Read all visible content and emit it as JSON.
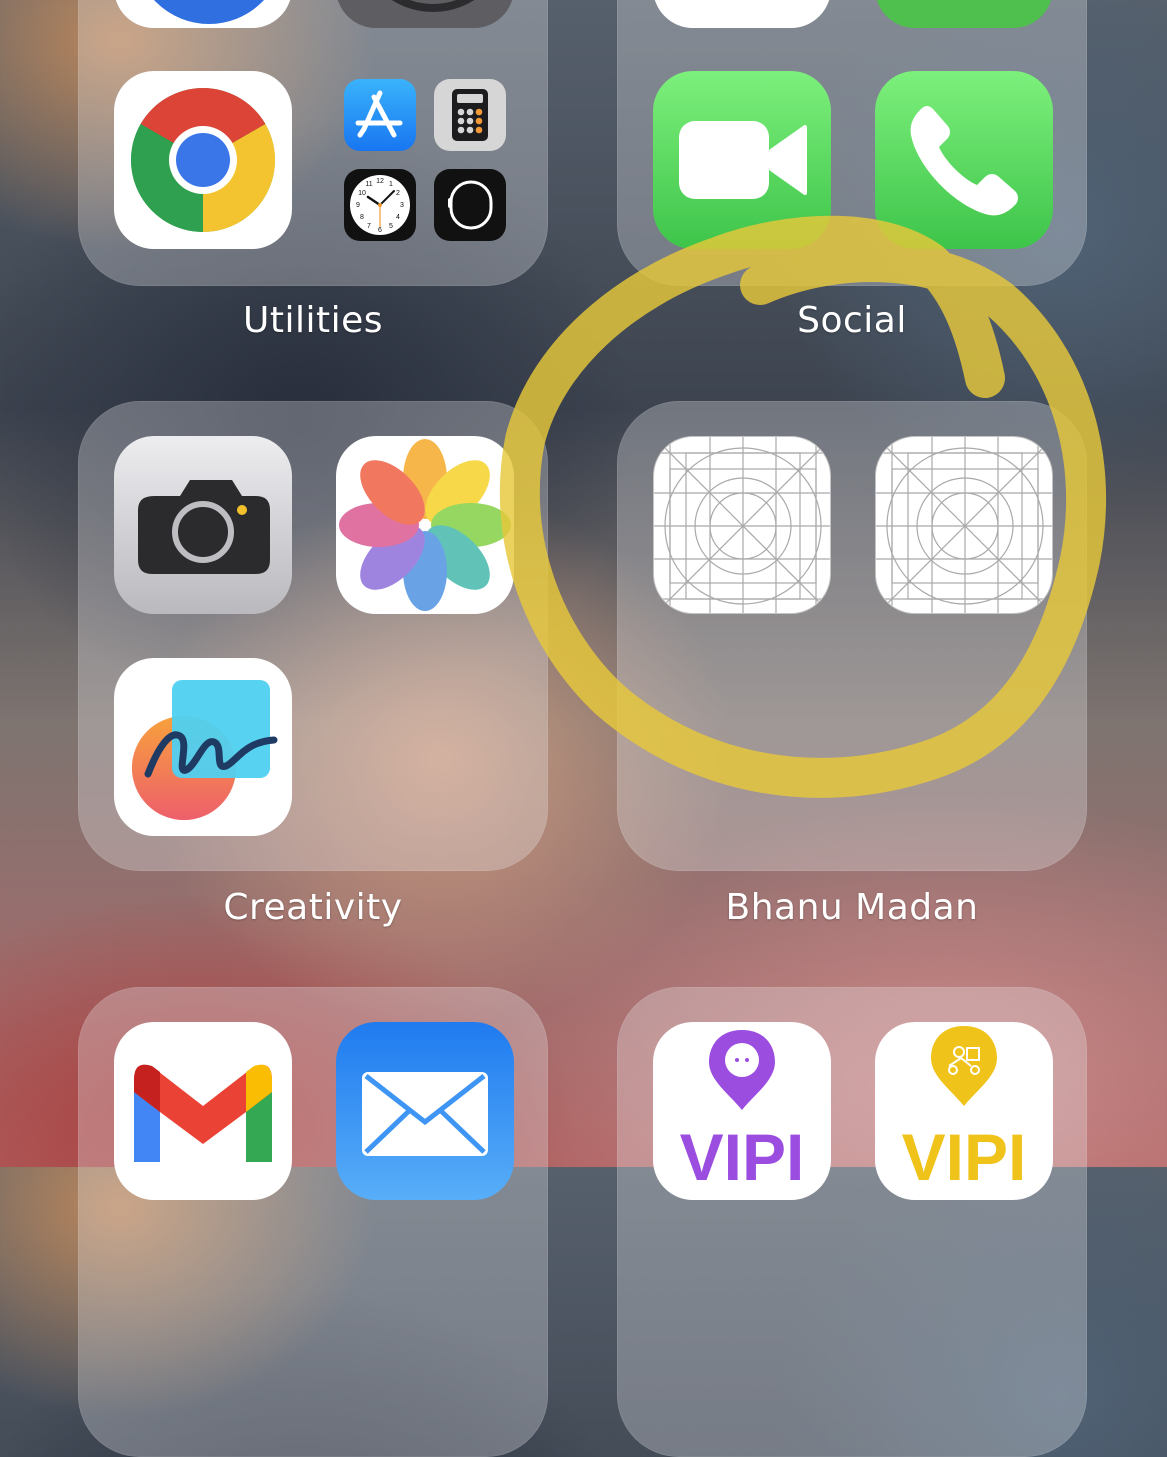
{
  "folders": {
    "utilities": {
      "label": "Utilities"
    },
    "social": {
      "label": "Social"
    },
    "creativity": {
      "label": "Creativity"
    },
    "bhanu_madan": {
      "label": "Bhanu Madan"
    }
  },
  "vipi_text": "VIPI",
  "colors": {
    "annotation_yellow": "#e6c83a",
    "facetime_green": "#5bd05a",
    "vipi_purple": "#9b4de0",
    "vipi_yellow": "#f0c31a"
  },
  "icons": [
    "chrome-icon",
    "app-store-icon",
    "calculator-icon",
    "clock-icon",
    "watch-icon",
    "facetime-icon",
    "phone-icon",
    "camera-icon",
    "photos-icon",
    "freeform-icon",
    "placeholder-app-icon",
    "gmail-icon",
    "mail-icon",
    "vipi-icon",
    "vipi-partner-icon"
  ],
  "clock_numbers": [
    "12",
    "1",
    "2",
    "3",
    "4",
    "5",
    "6",
    "7",
    "8",
    "9",
    "10",
    "11"
  ]
}
